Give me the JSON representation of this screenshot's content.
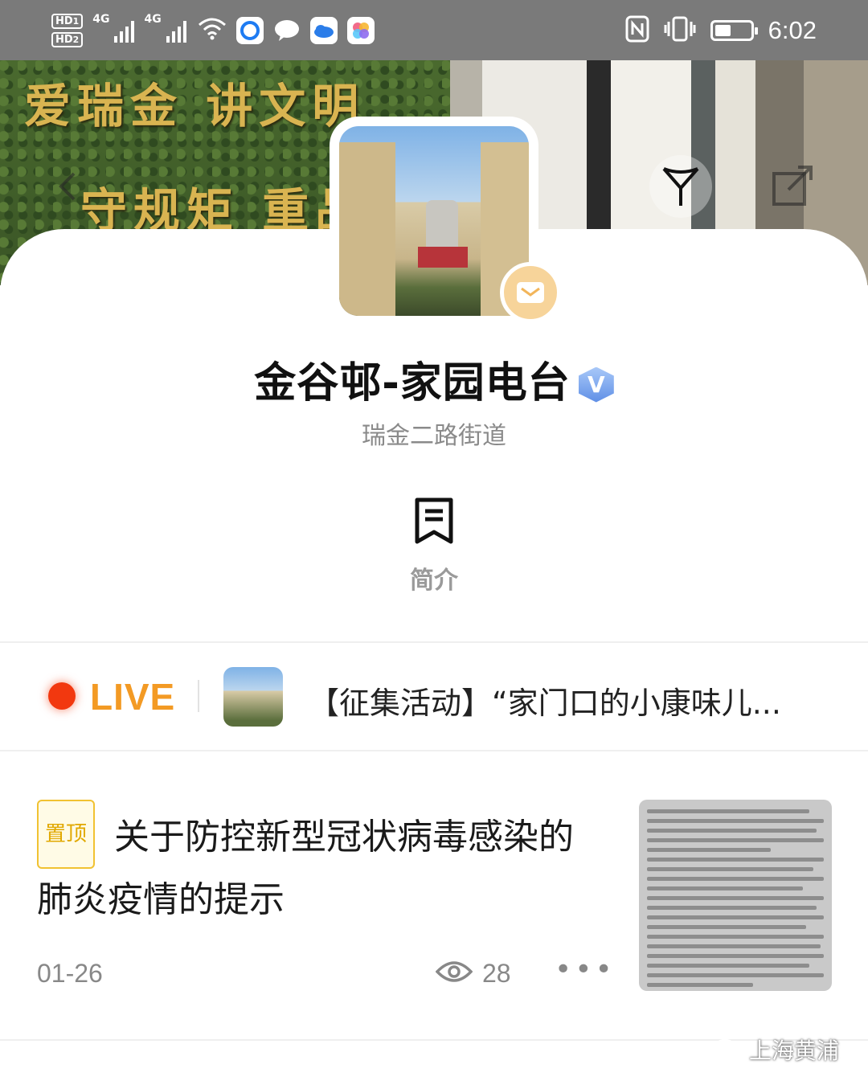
{
  "status_bar": {
    "hd1": "HD",
    "hd1_sub": "1",
    "hd2": "HD",
    "hd2_sub": "2",
    "net1": "4G",
    "net2": "4G",
    "time": "6:02"
  },
  "header": {
    "hedge_line1": "爱瑞金 讲文明",
    "hedge_line2": "守规矩 重品"
  },
  "profile": {
    "name": "金谷邨-家园电台",
    "verified_mark": "V",
    "subtitle": "瑞金二路街道",
    "intro_label": "简介"
  },
  "live": {
    "label": "LIVE",
    "title": "【征集活动】“家门口的小康味儿..."
  },
  "article": {
    "pin_label": "置顶",
    "title": "关于防控新型冠状病毒感染的肺炎疫情的提示",
    "date": "01-26",
    "views": "28"
  },
  "watermark": {
    "text": "上海黄浦"
  },
  "colors": {
    "live_dot": "#f2380f",
    "live_text": "#f39a24",
    "pin": "#e1a800",
    "verified": "#5f8fe6"
  }
}
